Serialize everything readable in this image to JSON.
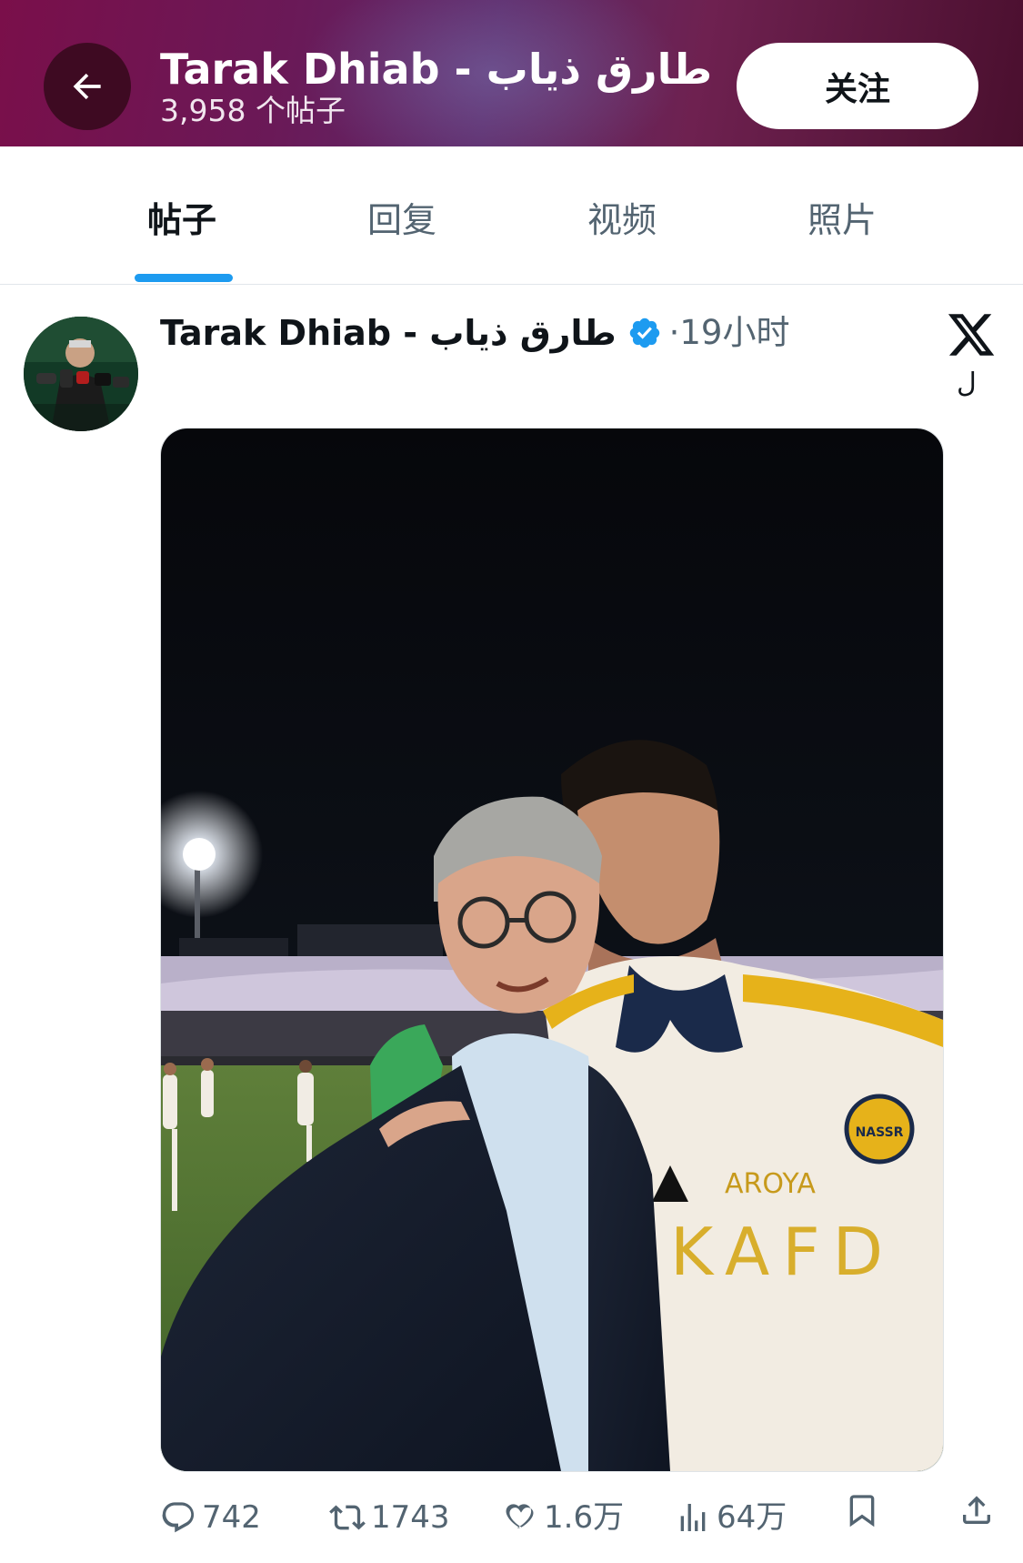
{
  "header": {
    "title": "Tarak Dhiab - طارق ذياب",
    "post_count": "3,958 个帖子",
    "follow_label": "关注"
  },
  "tabs": [
    {
      "label": "帖子",
      "active": true
    },
    {
      "label": "回复",
      "active": false
    },
    {
      "label": "视频",
      "active": false
    },
    {
      "label": "照片",
      "active": false
    }
  ],
  "post": {
    "author": "Tarak Dhiab - طارق ذياب",
    "time": "·19小时",
    "stats": {
      "replies": "742",
      "reposts": "1743",
      "likes": "1.6万",
      "views": "64万"
    },
    "jersey_text": {
      "sponsor": "AROYA",
      "kit": "KAFD",
      "badge": "NASSR"
    }
  },
  "colors": {
    "accent": "#1d9bf0",
    "header_bg": "#6a1957",
    "text_secondary": "#536471"
  },
  "icons": [
    "back-arrow-icon",
    "verified-icon",
    "x-logo-icon",
    "reply-icon",
    "repost-icon",
    "like-icon",
    "views-icon",
    "bookmark-icon",
    "share-icon"
  ]
}
